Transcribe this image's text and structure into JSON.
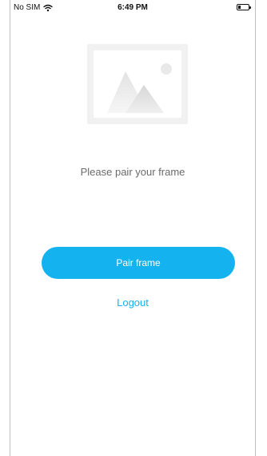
{
  "status_bar": {
    "carrier": "No SIM",
    "time": "6:49 PM",
    "wifi_icon": "wifi-icon",
    "battery_icon": "battery-icon",
    "battery_level": 0.25
  },
  "illustration": {
    "icon": "image-placeholder-icon"
  },
  "main": {
    "prompt": "Please pair your frame",
    "pair_button_label": "Pair frame",
    "logout_label": "Logout"
  },
  "colors": {
    "accent": "#14b3f0",
    "prompt_text": "#6b6b6b",
    "illustration_bg": "#f1f1f1"
  }
}
